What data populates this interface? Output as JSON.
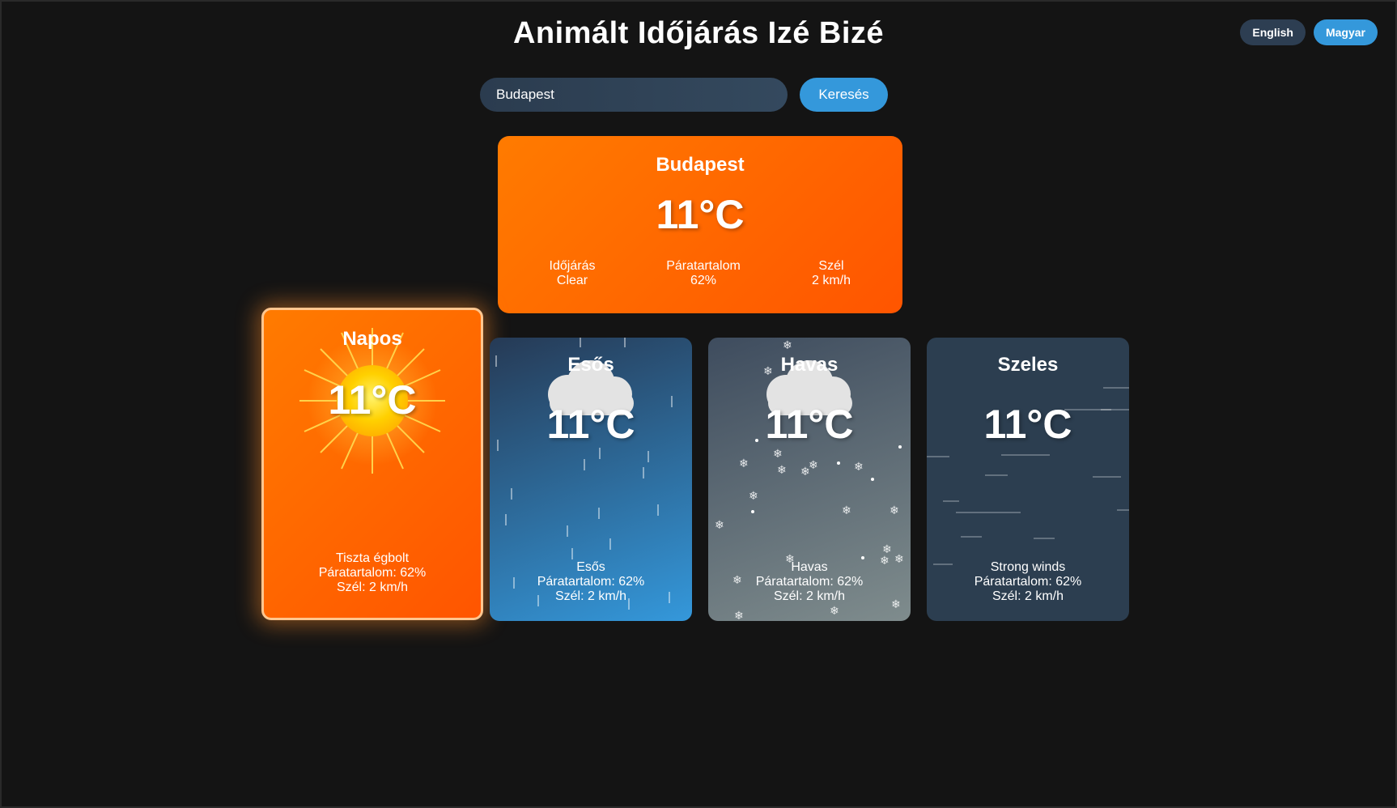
{
  "app": {
    "title": "Animált Időjárás Izé Bizé"
  },
  "language": {
    "english_label": "English",
    "hungarian_label": "Magyar"
  },
  "search": {
    "value": "Budapest",
    "button_label": "Keresés"
  },
  "current": {
    "city": "Budapest",
    "temperature": "11°C",
    "weather_label": "Időjárás",
    "weather_value": "Clear",
    "humidity_label": "Páratartalom",
    "humidity_value": "62%",
    "wind_label": "Szél",
    "wind_value": "2 km/h"
  },
  "cards": [
    {
      "name": "Napos",
      "temperature": "11°C",
      "description": "Tiszta égbolt",
      "humidity": "Páratartalom: 62%",
      "wind": "Szél: 2 km/h",
      "icon": "sun-icon"
    },
    {
      "name": "Esős",
      "temperature": "11°C",
      "description": "Esős",
      "humidity": "Páratartalom: 62%",
      "wind": "Szél: 2 km/h",
      "icon": "cloud-icon"
    },
    {
      "name": "Havas",
      "temperature": "11°C",
      "description": "Havas",
      "humidity": "Páratartalom: 62%",
      "wind": "Szél: 2 km/h",
      "icon": "cloud-icon"
    },
    {
      "name": "Szeles",
      "temperature": "11°C",
      "description": "Strong winds",
      "humidity": "Páratartalom: 62%",
      "wind": "Szél: 2 km/h",
      "icon": "wind-lines-icon"
    }
  ],
  "colors": {
    "accent": "#3498db",
    "sunny": "#ff6a00",
    "rainy": "#3498db",
    "snowy": "#7f8c8d",
    "windy": "#2c3e50"
  }
}
